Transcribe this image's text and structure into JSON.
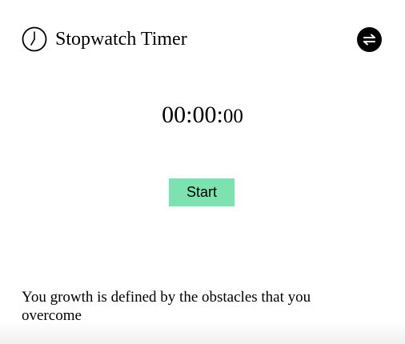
{
  "header": {
    "title": "Stopwatch Timer",
    "clock_icon": "clock-icon",
    "toggle_icon": "swap-arrows-icon"
  },
  "timer": {
    "hours_minutes_seconds": "00:00:",
    "milliseconds": "00"
  },
  "controls": {
    "start_label": "Start"
  },
  "quote": {
    "text": "You growth is defined by the obstacles that you overcome"
  },
  "colors": {
    "start_button": "#7ee2b0",
    "toggle_background": "#000000",
    "background": "#ffffff"
  }
}
